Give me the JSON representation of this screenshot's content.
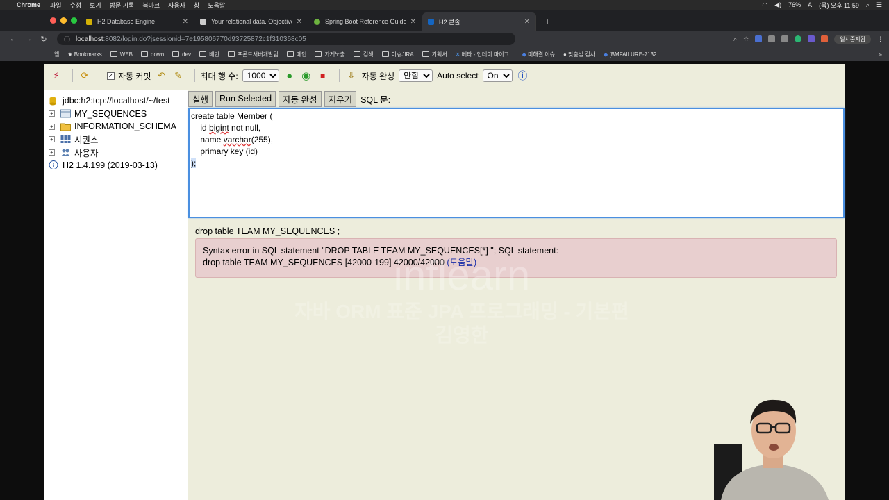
{
  "mac_menu": {
    "app": "Chrome",
    "items": [
      "파일",
      "수정",
      "보기",
      "방문 기록",
      "북마크",
      "사용자",
      "창",
      "도움말"
    ],
    "battery": "76%",
    "clock": "(목) 오후 11:59"
  },
  "tabs": [
    {
      "title": "H2 Database Engine",
      "color": "#d4b106"
    },
    {
      "title": "Your relational data. Objectively",
      "color": "#cccccc"
    },
    {
      "title": "Spring Boot Reference Guide",
      "color": "#6db33f"
    },
    {
      "title": "H2 콘솔",
      "color": "#1565c0"
    }
  ],
  "address": {
    "host": "localhost",
    "path": ":8082/login.do?jsessionid=7e195806770d93725872c1f310368c05",
    "profile": "일시중지됨"
  },
  "bookmarks": [
    "앱",
    "Bookmarks",
    "WEB",
    "down",
    "dev",
    "배민",
    "프론트서버개발팀",
    "메인",
    "가게노출",
    "검색",
    "이슈JIRA",
    "기획서",
    "베타 - 언데이 마이그...",
    "미해결 이슈",
    "맞춤법 검사",
    "[BMFAILURE-7132..."
  ],
  "toolbar": {
    "autocommit_label": "자동 커밋",
    "maxrows_label": "최대 행 수:",
    "maxrows_value": "1000",
    "autocomplete_label": "자동 완성",
    "autocomplete_value": "안함",
    "autoselect_label": "Auto select",
    "autoselect_value": "On"
  },
  "sidebar": {
    "connection": "jdbc:h2:tcp://localhost/~/test",
    "items": [
      "MY_SEQUENCES",
      "INFORMATION_SCHEMA",
      "시퀀스",
      "사용자"
    ],
    "version": "H2 1.4.199 (2019-03-13)"
  },
  "commands": {
    "run": "실행",
    "run_selected": "Run Selected",
    "autocomplete": "자동 완성",
    "clear": "지우기",
    "sql_label": "SQL 문:"
  },
  "editor": {
    "line1": "create table Member (",
    "line2a": "    id ",
    "line2b": "bigint",
    "line2c": " not null,",
    "line3a": "    name ",
    "line3b": "varchar",
    "line3c": "(255),",
    "line4": "    primary key (id)",
    "line5": ");"
  },
  "result": {
    "statement": "drop table TEAM MY_SEQUENCES  ;",
    "error_line1": "Syntax error in SQL statement \"DROP TABLE TEAM MY_SEQUENCES[*] \"; SQL statement:",
    "error_line2": "drop table TEAM MY_SEQUENCES [42000-199] 42000/42000 ",
    "help_link": "(도움말)"
  },
  "watermark": {
    "brand": "inflearn",
    "line1": "자바 ORM 표준 JPA 프로그래밍 - 기본편",
    "line2": "김영한"
  }
}
